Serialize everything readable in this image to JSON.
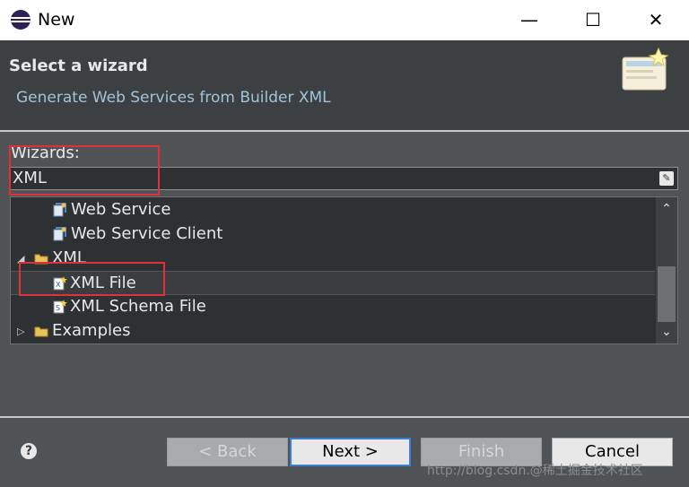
{
  "window": {
    "title": "New",
    "minimize_glyph": "—",
    "maximize_glyph": "☐",
    "close_glyph": "✕"
  },
  "header": {
    "title": "Select a wizard",
    "subtitle": "Generate Web Services from Builder XML",
    "banner_icon": "wizard-banner-icon"
  },
  "wizards": {
    "label": "Wizards:",
    "filter_value": "XML",
    "clear_icon": "eraser-icon"
  },
  "tree": {
    "items": [
      {
        "label": "Web Service",
        "level": 2,
        "icon": "web-service-icon"
      },
      {
        "label": "Web Service Client",
        "level": 2,
        "icon": "web-service-client-icon"
      },
      {
        "label": "XML",
        "level": 1,
        "icon": "folder-icon",
        "expanded": true
      },
      {
        "label": "XML File",
        "level": 2,
        "icon": "xml-file-icon",
        "selected": true
      },
      {
        "label": "XML Schema File",
        "level": 2,
        "icon": "xml-schema-file-icon"
      },
      {
        "label": "Examples",
        "level": 1,
        "icon": "folder-icon",
        "expanded": false
      }
    ]
  },
  "buttons": {
    "back": "< Back",
    "next": "Next >",
    "finish": "Finish",
    "cancel": "Cancel"
  },
  "colors": {
    "accent": "#3c7fd6",
    "annotation": "#e0303a",
    "subtitle": "#9fc4d9"
  },
  "watermark": "http://blog.csdn.@稀土掘金技术社区"
}
